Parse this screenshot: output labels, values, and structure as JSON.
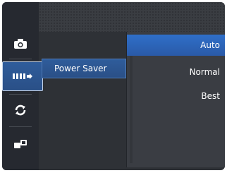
{
  "sidebar": {
    "items": [
      {
        "icon": "camera-icon"
      },
      {
        "icon": "power-saver-icon",
        "active": true
      },
      {
        "icon": "refresh-icon"
      },
      {
        "icon": "connect-icon"
      }
    ]
  },
  "menu": {
    "selected_label": "Power Saver"
  },
  "submenu": {
    "options": [
      "Auto",
      "Normal",
      "Best"
    ],
    "selected_index": 0
  },
  "colors": {
    "accent": "#2f5d9c",
    "selected_option": "#2f6fc9",
    "background": "#2e3136"
  }
}
